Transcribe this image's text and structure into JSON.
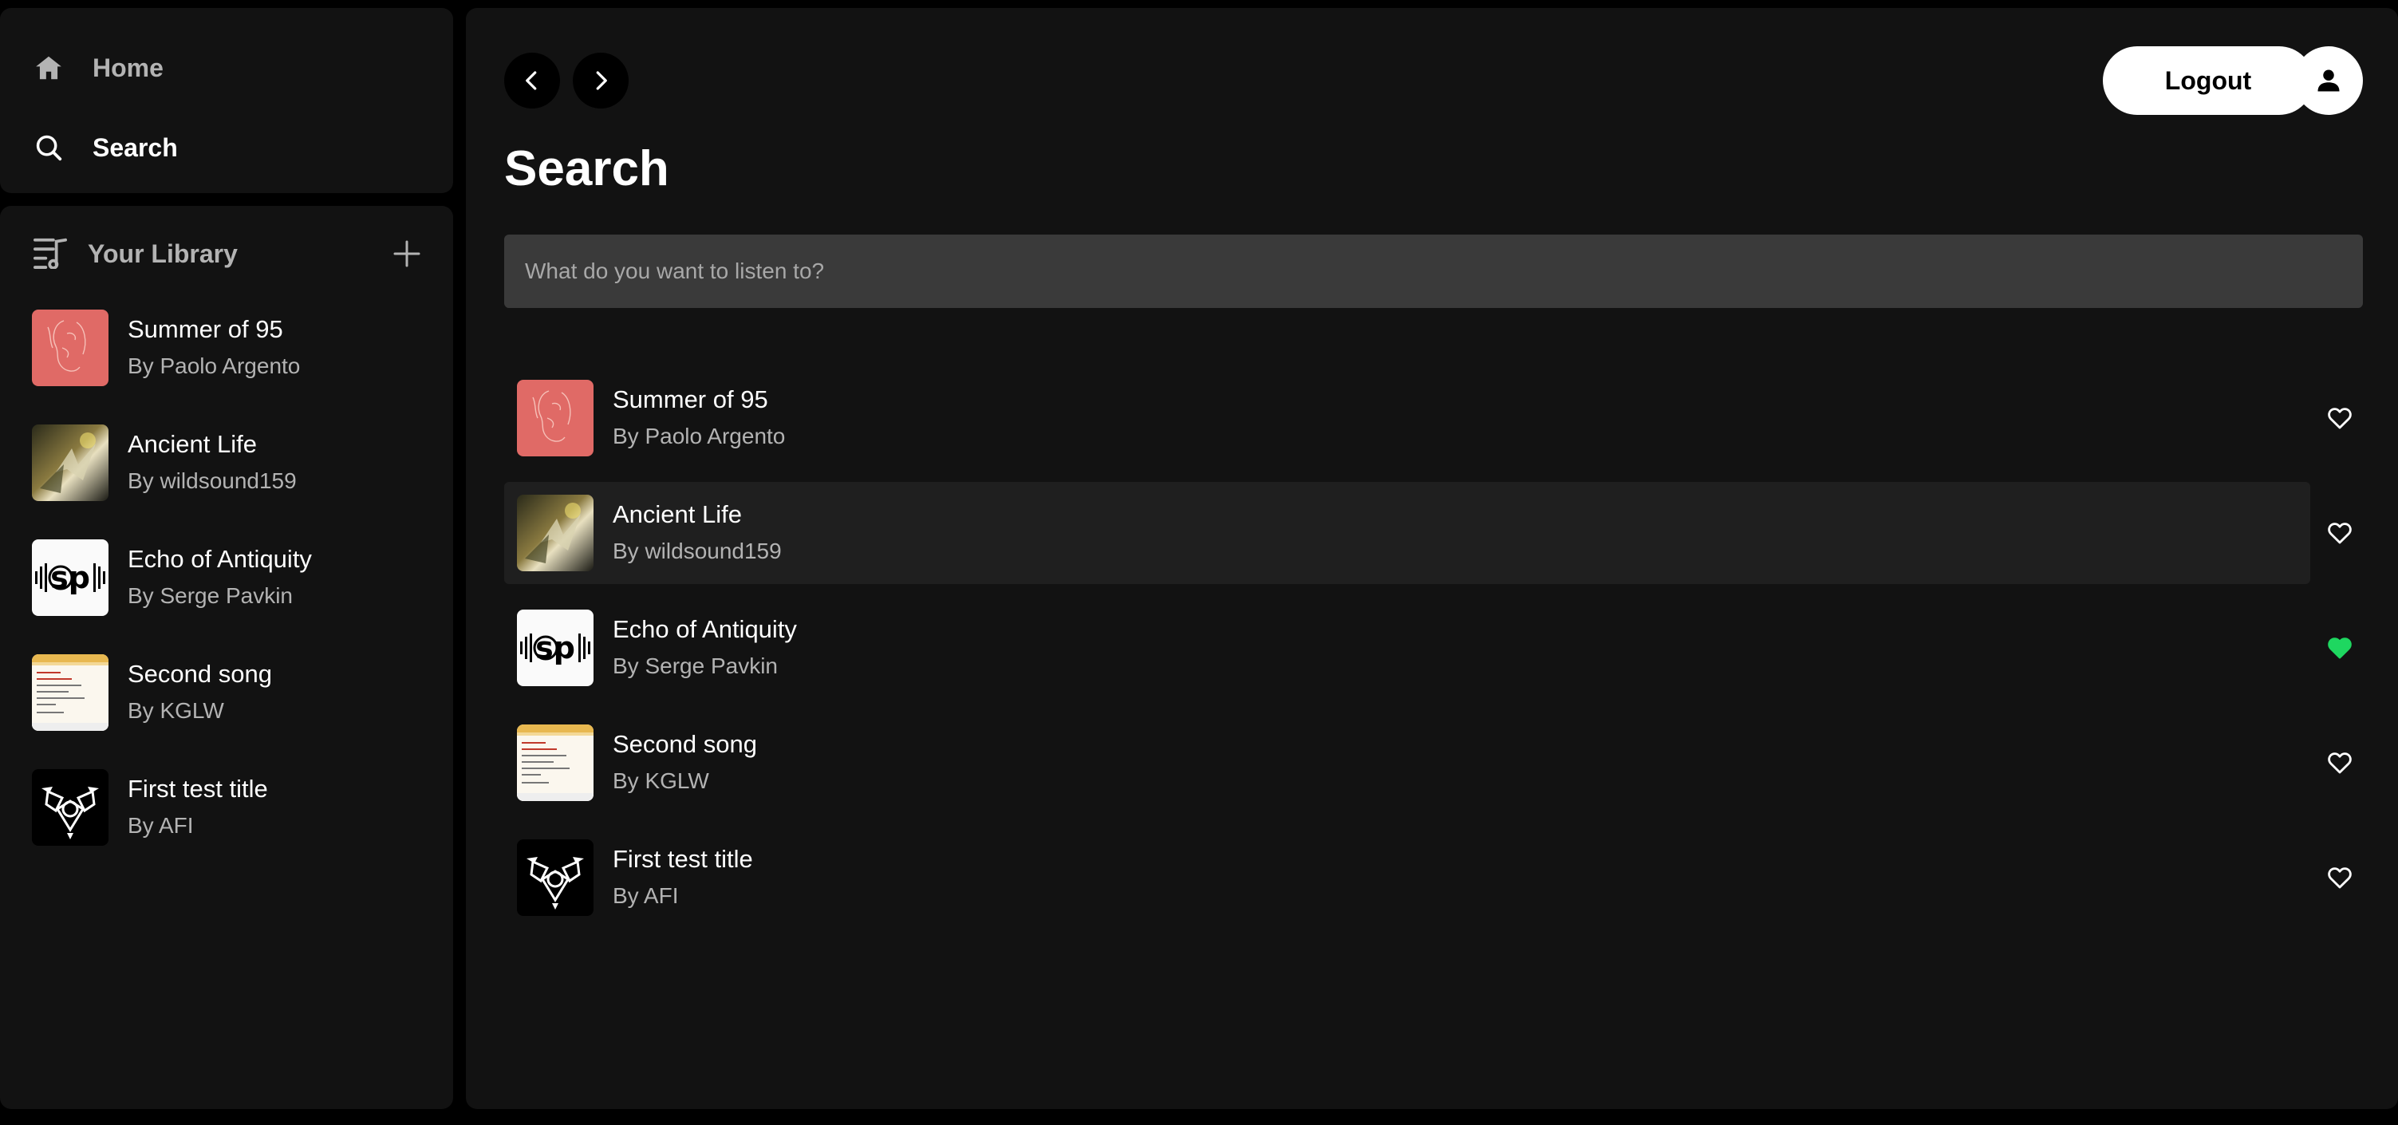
{
  "nav": {
    "home_label": "Home",
    "search_label": "Search"
  },
  "library": {
    "title": "Your Library",
    "items": [
      {
        "title": "Summer of 95",
        "subtitle": "By Paolo Argento",
        "cover": "summer-cover"
      },
      {
        "title": "Ancient Life",
        "subtitle": "By wildsound159",
        "cover": "ancient-cover"
      },
      {
        "title": "Echo of Antiquity",
        "subtitle": "By Serge Pavkin",
        "cover": "sp-cover"
      },
      {
        "title": "Second song",
        "subtitle": "By KGLW",
        "cover": "doc-cover"
      },
      {
        "title": "First test title",
        "subtitle": "By AFI",
        "cover": "afi-cover"
      }
    ]
  },
  "header": {
    "logout_label": "Logout"
  },
  "main": {
    "title": "Search",
    "search_placeholder": "What do you want to listen to?",
    "results": [
      {
        "title": "Summer of 95",
        "subtitle": "By Paolo Argento",
        "liked": false
      },
      {
        "title": "Ancient Life",
        "subtitle": "By wildsound159",
        "liked": false
      },
      {
        "title": "Echo of Antiquity",
        "subtitle": "By Serge Pavkin",
        "liked": true
      },
      {
        "title": "Second song",
        "subtitle": "By KGLW",
        "liked": false
      },
      {
        "title": "First test title",
        "subtitle": "By AFI",
        "liked": false
      }
    ]
  },
  "colors": {
    "background": "#000000",
    "panel": "#121212",
    "input_bg": "#3a3a3a",
    "muted_text": "#b3b3b3",
    "liked_green": "#1ed760"
  }
}
